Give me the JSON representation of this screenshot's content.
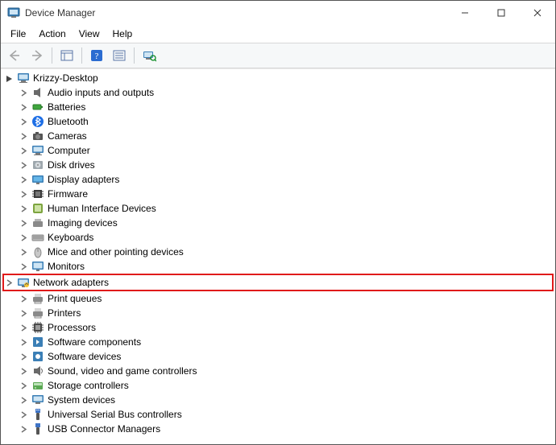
{
  "window": {
    "title": "Device Manager"
  },
  "menubar": {
    "file": "File",
    "action": "Action",
    "view": "View",
    "help": "Help"
  },
  "tree": {
    "root": "Krizzy-Desktop",
    "items": [
      {
        "label": "Audio inputs and outputs",
        "icon": "audio"
      },
      {
        "label": "Batteries",
        "icon": "battery"
      },
      {
        "label": "Bluetooth",
        "icon": "bluetooth"
      },
      {
        "label": "Cameras",
        "icon": "camera"
      },
      {
        "label": "Computer",
        "icon": "computer"
      },
      {
        "label": "Disk drives",
        "icon": "disk"
      },
      {
        "label": "Display adapters",
        "icon": "display"
      },
      {
        "label": "Firmware",
        "icon": "firmware"
      },
      {
        "label": "Human Interface Devices",
        "icon": "hid"
      },
      {
        "label": "Imaging devices",
        "icon": "imaging"
      },
      {
        "label": "Keyboards",
        "icon": "keyboard"
      },
      {
        "label": "Mice and other pointing devices",
        "icon": "mouse"
      },
      {
        "label": "Monitors",
        "icon": "monitor"
      },
      {
        "label": "Network adapters",
        "icon": "network",
        "highlight": true
      },
      {
        "label": "Print queues",
        "icon": "printq"
      },
      {
        "label": "Printers",
        "icon": "printer"
      },
      {
        "label": "Processors",
        "icon": "cpu"
      },
      {
        "label": "Software components",
        "icon": "swcomp"
      },
      {
        "label": "Software devices",
        "icon": "swdev"
      },
      {
        "label": "Sound, video and game controllers",
        "icon": "sound"
      },
      {
        "label": "Storage controllers",
        "icon": "storage"
      },
      {
        "label": "System devices",
        "icon": "system"
      },
      {
        "label": "Universal Serial Bus controllers",
        "icon": "usb"
      },
      {
        "label": "USB Connector Managers",
        "icon": "usbconn"
      }
    ]
  }
}
